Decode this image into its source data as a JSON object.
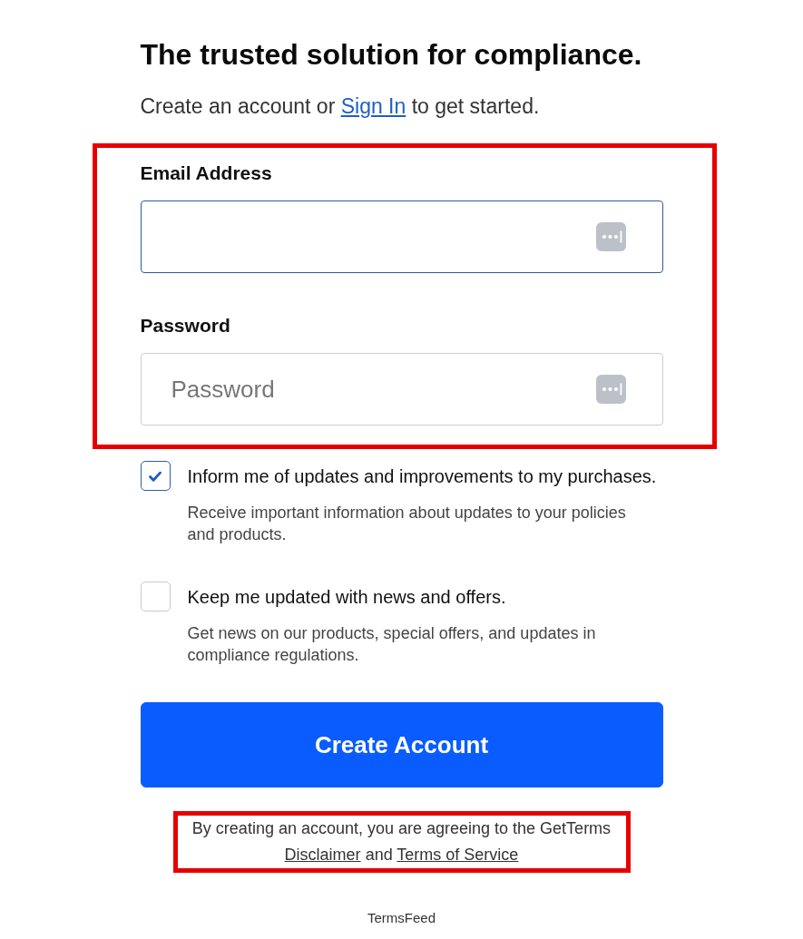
{
  "heading": "The trusted solution for compliance.",
  "intro": [
    {
      "kind": "text",
      "text": "Create an account or "
    },
    {
      "kind": "link",
      "text": "Sign In"
    },
    {
      "kind": "text",
      "text": " to get started."
    }
  ],
  "credentials": {
    "highlighted": true,
    "fields": [
      {
        "label": "Email Address",
        "focused": true
      },
      {
        "label": "Password",
        "placeholder": "Password",
        "focused": false
      }
    ]
  },
  "options": [
    {
      "label": "Inform me of updates and improvements to my purchases.",
      "description": "Receive important information about updates to your policies and products.",
      "checked": true
    },
    {
      "label": "Keep me updated with news and offers.",
      "description": "Get news on our products, special offers, and updates in compliance regulations.",
      "checked": false
    }
  ],
  "submit_button": "Create Account",
  "legal": {
    "highlighted": true,
    "parts": [
      {
        "kind": "text",
        "text": "By creating an account, you are agreeing to the GetTerms "
      },
      {
        "kind": "link",
        "text": "Disclaimer"
      },
      {
        "kind": "text",
        "text": " and "
      },
      {
        "kind": "link",
        "text": "Terms of Service"
      }
    ]
  },
  "footer": "TermsFeed"
}
